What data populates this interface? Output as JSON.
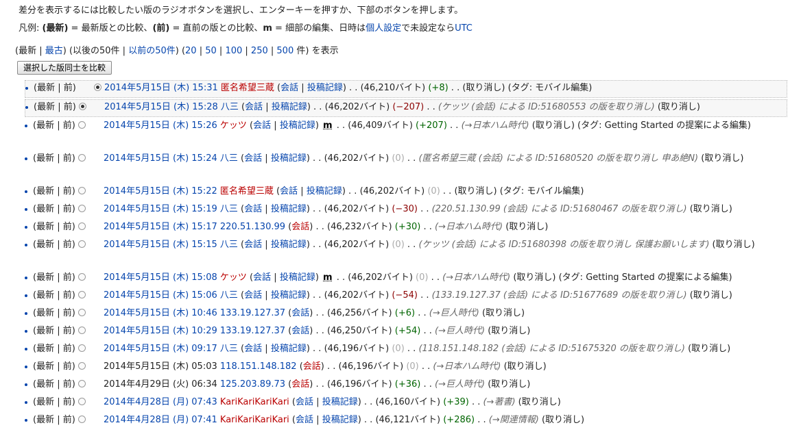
{
  "header": {
    "instruction": "差分を表示するには比較したい版のラジオボタンを選択し、エンターキーを押すか、下部のボタンを押します。",
    "legend_prefix": "凡例: ",
    "legend_latest_key": "(最新)",
    "legend_latest_desc": " = 最新版との比較、",
    "legend_prev_key": "(前)",
    "legend_prev_desc": " = 直前の版との比較、",
    "legend_minor_key": "m",
    "legend_minor_desc": " = 細部の編集、日時は",
    "legend_pref_link": "個人設定",
    "legend_mid": "で未設定なら",
    "legend_utc_link": "UTC"
  },
  "nav": {
    "open": "(最新 | ",
    "oldest": "最古",
    "mid": ") (以後の50件 | ",
    "prev50": "以前の50件",
    "mid2": ") (",
    "counts": [
      "20",
      "50",
      "100",
      "250",
      "500"
    ],
    "suffix": " 件) を表示"
  },
  "compare_button": "選択した版同士を比較",
  "common": {
    "latest": "最新",
    "prev": "前",
    "talk": "会話",
    "contribs": "投稿記録",
    "undo": "取り消し",
    "minor_mark": "m"
  },
  "rows": [
    {
      "date": "2014年5月15日 (木) 15:31",
      "user": "匿名希望三蔵",
      "user_red": true,
      "contribs": true,
      "size": "(46,210バイト)",
      "diff": "(+8)",
      "diff_type": "pos",
      "comment": "",
      "tail": "(取り消し) (タグ: モバイル編集)"
    },
    {
      "date": "2014年5月15日 (木) 15:28",
      "user": "八三",
      "user_red": false,
      "contribs": true,
      "size": "(46,202バイト)",
      "diff": "(−207)",
      "diff_type": "neg",
      "comment": "(ケッツ (会話) による ID:51680553 の版を取り消し)",
      "tail": "(取り消し)"
    },
    {
      "date": "2014年5月15日 (木) 15:26",
      "user": "ケッツ",
      "user_red": true,
      "contribs": true,
      "minor": true,
      "size": "(46,409バイト)",
      "diff": "(+207)",
      "diff_type": "pos",
      "comment": "(→日本ハム時代)",
      "tail": "(取り消し) (タグ: Getting Started の提案による編集)"
    },
    {
      "date": "2014年5月15日 (木) 15:24",
      "user": "八三",
      "user_red": false,
      "contribs": true,
      "size": "(46,202バイト)",
      "diff": "(0)",
      "diff_type": "zero",
      "comment": "(匿名希望三蔵 (会話) による ID:51680520 の版を取り消し 申あ絶N)",
      "tail": "(取り消し)"
    },
    {
      "date": "2014年5月15日 (木) 15:22",
      "user": "匿名希望三蔵",
      "user_red": true,
      "contribs": true,
      "size": "(46,202バイト)",
      "diff": "(0)",
      "diff_type": "zero",
      "comment": "",
      "tail": "(取り消し) (タグ: モバイル編集)"
    },
    {
      "date": "2014年5月15日 (木) 15:19",
      "user": "八三",
      "user_red": false,
      "contribs": true,
      "size": "(46,202バイト)",
      "diff": "(−30)",
      "diff_type": "neg",
      "comment": "(220.51.130.99 (会話) による ID:51680467 の版を取り消し)",
      "tail": "(取り消し)"
    },
    {
      "date": "2014年5月15日 (木) 15:17",
      "user": "220.51.130.99",
      "user_red": false,
      "contribs": false,
      "talk_red": true,
      "size": "(46,232バイト)",
      "diff": "(+30)",
      "diff_type": "pos",
      "comment": "(→日本ハム時代)",
      "tail": "(取り消し)"
    },
    {
      "date": "2014年5月15日 (木) 15:15",
      "user": "八三",
      "user_red": false,
      "contribs": true,
      "size": "(46,202バイト)",
      "diff": "(0)",
      "diff_type": "zero",
      "comment": "(ケッツ (会話) による ID:51680398 の版を取り消し 保護お願いします)",
      "tail": "(取り消し)"
    },
    {
      "date": "2014年5月15日 (木) 15:08",
      "user": "ケッツ",
      "user_red": true,
      "contribs": true,
      "minor": true,
      "size": "(46,202バイト)",
      "diff": "(0)",
      "diff_type": "zero",
      "comment": "(→日本ハム時代)",
      "tail": "(取り消し) (タグ: Getting Started の提案による編集)"
    },
    {
      "date": "2014年5月15日 (木) 15:06",
      "user": "八三",
      "user_red": false,
      "contribs": true,
      "size": "(46,202バイト)",
      "diff": "(−54)",
      "diff_type": "neg",
      "comment": "(133.19.127.37 (会話) による ID:51677689 の版を取り消し)",
      "tail": "(取り消し)"
    },
    {
      "date": "2014年5月15日 (木) 10:46",
      "user": "133.19.127.37",
      "user_red": false,
      "contribs": false,
      "size": "(46,256バイト)",
      "diff": "(+6)",
      "diff_type": "pos",
      "comment": "(→巨人時代)",
      "tail": "(取り消し)"
    },
    {
      "date": "2014年5月15日 (木) 10:29",
      "user": "133.19.127.37",
      "user_red": false,
      "contribs": false,
      "size": "(46,250バイト)",
      "diff": "(+54)",
      "diff_type": "pos",
      "comment": "(→巨人時代)",
      "tail": "(取り消し)"
    },
    {
      "date": "2014年5月15日 (木) 09:17",
      "user": "八三",
      "user_red": false,
      "contribs": true,
      "size": "(46,196バイト)",
      "diff": "(0)",
      "diff_type": "zero",
      "comment": "(118.151.148.182 (会話) による ID:51675320 の版を取り消し)",
      "tail": "(取り消し)"
    },
    {
      "date": "2014年5月15日 (木) 05:03",
      "user": "118.151.148.182",
      "user_red": false,
      "contribs": false,
      "talk_red": true,
      "size": "(46,196バイト)",
      "diff": "(0)",
      "diff_type": "zero",
      "comment": "(→日本ハム時代)",
      "tail": "(取り消し)",
      "date_plain": true
    },
    {
      "date": "2014年4月29日 (火) 06:34",
      "user": "125.203.89.73",
      "user_red": false,
      "contribs": false,
      "talk_red": true,
      "size": "(46,196バイト)",
      "diff": "(+36)",
      "diff_type": "pos",
      "comment": "(→巨人時代)",
      "tail": "(取り消し)",
      "date_plain": true
    },
    {
      "date": "2014年4月28日 (月) 07:43",
      "user": "KariKariKariKari",
      "user_red": true,
      "contribs": true,
      "size": "(46,160バイト)",
      "diff": "(+39)",
      "diff_type": "pos",
      "comment": "(→著書)",
      "tail": "(取り消し)"
    },
    {
      "date": "2014年4月28日 (月) 07:41",
      "user": "KariKariKariKari",
      "user_red": true,
      "contribs": true,
      "size": "(46,121バイト)",
      "diff": "(+286)",
      "diff_type": "pos",
      "comment": "(→関連情報)",
      "tail": "(取り消し)"
    }
  ]
}
